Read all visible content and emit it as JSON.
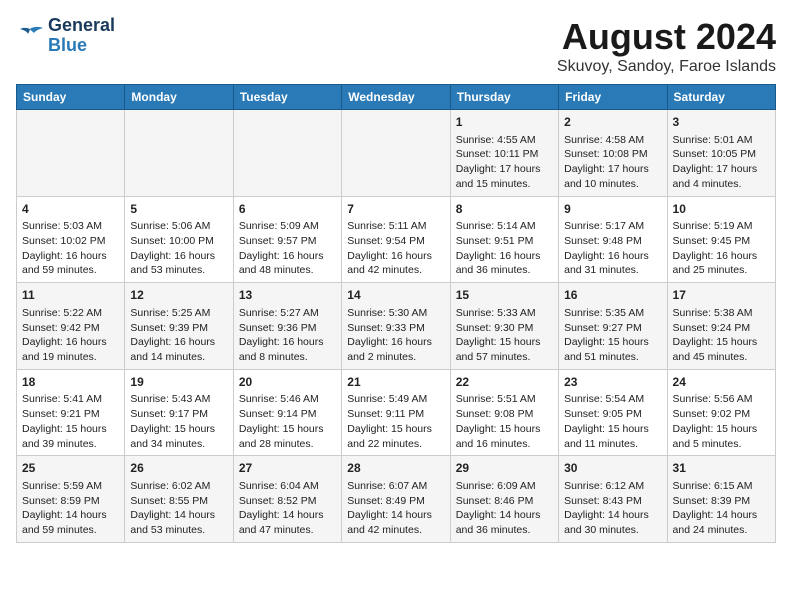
{
  "header": {
    "logo_line1": "General",
    "logo_line2": "Blue",
    "title": "August 2024",
    "subtitle": "Skuvoy, Sandoy, Faroe Islands"
  },
  "days_of_week": [
    "Sunday",
    "Monday",
    "Tuesday",
    "Wednesday",
    "Thursday",
    "Friday",
    "Saturday"
  ],
  "weeks": [
    [
      {
        "day": "",
        "content": ""
      },
      {
        "day": "",
        "content": ""
      },
      {
        "day": "",
        "content": ""
      },
      {
        "day": "",
        "content": ""
      },
      {
        "day": "1",
        "content": "Sunrise: 4:55 AM\nSunset: 10:11 PM\nDaylight: 17 hours\nand 15 minutes."
      },
      {
        "day": "2",
        "content": "Sunrise: 4:58 AM\nSunset: 10:08 PM\nDaylight: 17 hours\nand 10 minutes."
      },
      {
        "day": "3",
        "content": "Sunrise: 5:01 AM\nSunset: 10:05 PM\nDaylight: 17 hours\nand 4 minutes."
      }
    ],
    [
      {
        "day": "4",
        "content": "Sunrise: 5:03 AM\nSunset: 10:02 PM\nDaylight: 16 hours\nand 59 minutes."
      },
      {
        "day": "5",
        "content": "Sunrise: 5:06 AM\nSunset: 10:00 PM\nDaylight: 16 hours\nand 53 minutes."
      },
      {
        "day": "6",
        "content": "Sunrise: 5:09 AM\nSunset: 9:57 PM\nDaylight: 16 hours\nand 48 minutes."
      },
      {
        "day": "7",
        "content": "Sunrise: 5:11 AM\nSunset: 9:54 PM\nDaylight: 16 hours\nand 42 minutes."
      },
      {
        "day": "8",
        "content": "Sunrise: 5:14 AM\nSunset: 9:51 PM\nDaylight: 16 hours\nand 36 minutes."
      },
      {
        "day": "9",
        "content": "Sunrise: 5:17 AM\nSunset: 9:48 PM\nDaylight: 16 hours\nand 31 minutes."
      },
      {
        "day": "10",
        "content": "Sunrise: 5:19 AM\nSunset: 9:45 PM\nDaylight: 16 hours\nand 25 minutes."
      }
    ],
    [
      {
        "day": "11",
        "content": "Sunrise: 5:22 AM\nSunset: 9:42 PM\nDaylight: 16 hours\nand 19 minutes."
      },
      {
        "day": "12",
        "content": "Sunrise: 5:25 AM\nSunset: 9:39 PM\nDaylight: 16 hours\nand 14 minutes."
      },
      {
        "day": "13",
        "content": "Sunrise: 5:27 AM\nSunset: 9:36 PM\nDaylight: 16 hours\nand 8 minutes."
      },
      {
        "day": "14",
        "content": "Sunrise: 5:30 AM\nSunset: 9:33 PM\nDaylight: 16 hours\nand 2 minutes."
      },
      {
        "day": "15",
        "content": "Sunrise: 5:33 AM\nSunset: 9:30 PM\nDaylight: 15 hours\nand 57 minutes."
      },
      {
        "day": "16",
        "content": "Sunrise: 5:35 AM\nSunset: 9:27 PM\nDaylight: 15 hours\nand 51 minutes."
      },
      {
        "day": "17",
        "content": "Sunrise: 5:38 AM\nSunset: 9:24 PM\nDaylight: 15 hours\nand 45 minutes."
      }
    ],
    [
      {
        "day": "18",
        "content": "Sunrise: 5:41 AM\nSunset: 9:21 PM\nDaylight: 15 hours\nand 39 minutes."
      },
      {
        "day": "19",
        "content": "Sunrise: 5:43 AM\nSunset: 9:17 PM\nDaylight: 15 hours\nand 34 minutes."
      },
      {
        "day": "20",
        "content": "Sunrise: 5:46 AM\nSunset: 9:14 PM\nDaylight: 15 hours\nand 28 minutes."
      },
      {
        "day": "21",
        "content": "Sunrise: 5:49 AM\nSunset: 9:11 PM\nDaylight: 15 hours\nand 22 minutes."
      },
      {
        "day": "22",
        "content": "Sunrise: 5:51 AM\nSunset: 9:08 PM\nDaylight: 15 hours\nand 16 minutes."
      },
      {
        "day": "23",
        "content": "Sunrise: 5:54 AM\nSunset: 9:05 PM\nDaylight: 15 hours\nand 11 minutes."
      },
      {
        "day": "24",
        "content": "Sunrise: 5:56 AM\nSunset: 9:02 PM\nDaylight: 15 hours\nand 5 minutes."
      }
    ],
    [
      {
        "day": "25",
        "content": "Sunrise: 5:59 AM\nSunset: 8:59 PM\nDaylight: 14 hours\nand 59 minutes."
      },
      {
        "day": "26",
        "content": "Sunrise: 6:02 AM\nSunset: 8:55 PM\nDaylight: 14 hours\nand 53 minutes."
      },
      {
        "day": "27",
        "content": "Sunrise: 6:04 AM\nSunset: 8:52 PM\nDaylight: 14 hours\nand 47 minutes."
      },
      {
        "day": "28",
        "content": "Sunrise: 6:07 AM\nSunset: 8:49 PM\nDaylight: 14 hours\nand 42 minutes."
      },
      {
        "day": "29",
        "content": "Sunrise: 6:09 AM\nSunset: 8:46 PM\nDaylight: 14 hours\nand 36 minutes."
      },
      {
        "day": "30",
        "content": "Sunrise: 6:12 AM\nSunset: 8:43 PM\nDaylight: 14 hours\nand 30 minutes."
      },
      {
        "day": "31",
        "content": "Sunrise: 6:15 AM\nSunset: 8:39 PM\nDaylight: 14 hours\nand 24 minutes."
      }
    ]
  ]
}
